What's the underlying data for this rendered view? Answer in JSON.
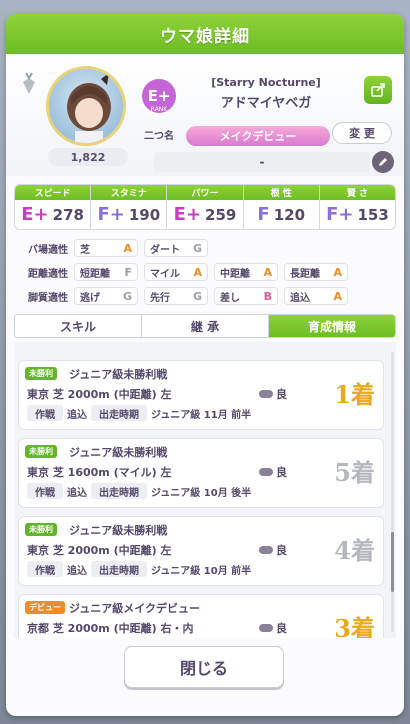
{
  "title": "ウマ娘詳細",
  "header": {
    "fans": "1,822",
    "rank": "E+",
    "rank_sub": "RANK",
    "rank_label": "二つ名",
    "epithet": "[Starry Nocturne]",
    "name": "アドマイヤベガ",
    "scenario": "メイクデビュー",
    "change_label": "変 更",
    "memo": "-"
  },
  "stats": [
    {
      "label": "スピード",
      "grade": "E+",
      "value": "278",
      "tone": "e"
    },
    {
      "label": "スタミナ",
      "grade": "F+",
      "value": "190",
      "tone": "f"
    },
    {
      "label": "パワー",
      "grade": "E+",
      "value": "259",
      "tone": "e"
    },
    {
      "label": "根 性",
      "grade": "F",
      "value": "120",
      "tone": "f"
    },
    {
      "label": "賢 さ",
      "grade": "F+",
      "value": "153",
      "tone": "f"
    }
  ],
  "aptitude": {
    "field_label": "バ場適性",
    "distance_label": "距離適性",
    "style_label": "脚質適性",
    "field": [
      [
        "芝",
        "A"
      ],
      [
        "ダート",
        "G"
      ]
    ],
    "distance": [
      [
        "短距離",
        "F"
      ],
      [
        "マイル",
        "A"
      ],
      [
        "中距離",
        "A"
      ],
      [
        "長距離",
        "A"
      ]
    ],
    "style": [
      [
        "逃げ",
        "G"
      ],
      [
        "先行",
        "G"
      ],
      [
        "差し",
        "B"
      ],
      [
        "追込",
        "A"
      ]
    ]
  },
  "tabs": [
    "スキル",
    "継 承",
    "育成情報"
  ],
  "races": [
    {
      "tag": "未勝利",
      "name": "ジュニア級未勝利戦",
      "course": "東京 芝 2000m (中距離) 左",
      "cond": "良",
      "style": "作戦",
      "style_value": "追込",
      "timing": "出走時期",
      "timing_value": "ジュニア級 11月 前半",
      "place": "1着"
    },
    {
      "tag": "未勝利",
      "name": "ジュニア級未勝利戦",
      "course": "東京 芝 1600m (マイル) 左",
      "cond": "良",
      "style": "作戦",
      "style_value": "追込",
      "timing": "出走時期",
      "timing_value": "ジュニア級 10月 後半",
      "place": "5着"
    },
    {
      "tag": "未勝利",
      "name": "ジュニア級未勝利戦",
      "course": "東京 芝 2000m (中距離) 左",
      "cond": "良",
      "style": "作戦",
      "style_value": "追込",
      "timing": "出走時期",
      "timing_value": "ジュニア級 10月 前半",
      "place": "4着"
    },
    {
      "tag": "デビュー",
      "name": "ジュニア級メイクデビュー",
      "course": "京都 芝 2000m (中距離) 右・内",
      "cond": "良",
      "style": "作戦",
      "style_value": "",
      "timing": "出走時期",
      "timing_value": "",
      "place": "3着"
    }
  ],
  "close_label": "閉じる"
}
